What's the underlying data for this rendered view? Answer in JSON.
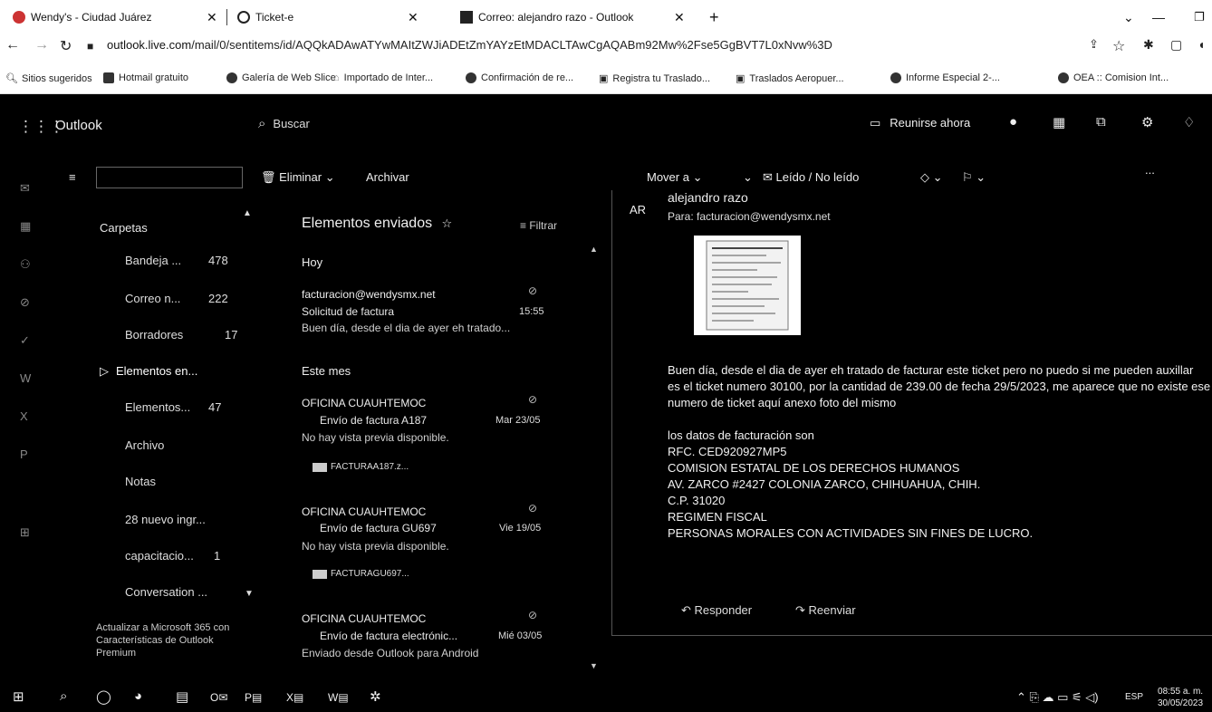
{
  "browser": {
    "tabs": [
      {
        "title": "Wendy's - Ciudad Juárez"
      },
      {
        "title": "Ticket-e"
      },
      {
        "title": "Correo: alejandro razo - Outlook"
      }
    ],
    "new_tab": "+",
    "url_host": "outlook.live.com",
    "url_path": "/mail/0/sentitems/id/AQQkADAwATYwMAItZWJiADEtZmYAYzEtMDACLTAwCgAQABm92Mw%2Fse5GgBVT7L0xNvw%3D",
    "bookmarks": [
      "Sitios sugeridos",
      "Hotmail gratuito",
      "Galería de Web Slice",
      "Importado de Inter...",
      "Confirmación de re...",
      "Registra tu Traslado...",
      "Traslados Aeropuer...",
      "Informe Especial 2-...",
      "OEA :: Comision Int..."
    ]
  },
  "outlook": {
    "brand": "Outlook",
    "search_placeholder": "Buscar",
    "meet_now": "Reunirse ahora",
    "commands": {
      "delete": "Eliminar",
      "archive": "Archivar",
      "move_to": "Mover a",
      "read_unread": "Leído / No leído",
      "more": "..."
    },
    "folders_title": "Carpetas",
    "folders": [
      {
        "label": "Bandeja ...",
        "count": "478"
      },
      {
        "label": "Correo n...",
        "count": "222"
      },
      {
        "label": "Borradores",
        "count": "17"
      },
      {
        "label": "Elementos en...",
        "count": ""
      },
      {
        "label": "Elementos...",
        "count": "47"
      },
      {
        "label": "Archivo",
        "count": ""
      },
      {
        "label": "Notas",
        "count": ""
      },
      {
        "label": "28 nuevo ingr...",
        "count": ""
      },
      {
        "label": "capacitacio...",
        "count": "1"
      },
      {
        "label": "Conversation ...",
        "count": ""
      }
    ],
    "upgrade_text": "Actualizar a Microsoft 365 con Características de Outlook Premium",
    "list": {
      "title": "Elementos enviados",
      "filter": "Filtrar",
      "groups": [
        "Hoy",
        "Este mes"
      ],
      "messages": [
        {
          "from": "facturacion@wendysmx.net",
          "subject": "Solicitud de factura",
          "date": "15:55",
          "preview": "Buen día, desde el dia de ayer eh tratado...",
          "attachment": ""
        },
        {
          "from": "OFICINA CUAUHTEMOC",
          "subject": "Envío de factura A187",
          "date": "Mar 23/05",
          "preview": "No hay vista previa disponible.",
          "attachment": "FACTURAA187.z..."
        },
        {
          "from": "OFICINA CUAUHTEMOC",
          "subject": "Envío de factura GU697",
          "date": "Vie 19/05",
          "preview": "No hay vista previa disponible.",
          "attachment": "FACTURAGU697..."
        },
        {
          "from": "OFICINA CUAUHTEMOC",
          "subject": "Envío de factura electrónic...",
          "date": "Mié 03/05",
          "preview": "Enviado desde Outlook para Android",
          "attachment": ""
        }
      ]
    },
    "reading": {
      "avatar": "AR",
      "sender": "alejandro razo",
      "to": "Para: facturacion@wendysmx.net",
      "body": [
        "Buen día, desde el dia de ayer eh tratado de facturar este ticket pero no puedo si me pueden auxillar",
        "es el ticket numero 30100, por la cantidad de 239.00 de fecha 29/5/2023, me aparece que no existe ese numero de ticket aquí anexo foto del mismo",
        "",
        "los datos de facturación son",
        "RFC. CED920927MP5",
        "COMISION ESTATAL DE LOS DERECHOS HUMANOS",
        "AV. ZARCO #2427 COLONIA ZARCO, CHIHUAHUA, CHIH.",
        "C.P. 31020",
        "REGIMEN FISCAL",
        "PERSONAS MORALES CON ACTIVIDADES SIN FINES DE LUCRO."
      ],
      "reply": "Responder",
      "forward": "Reenviar"
    }
  },
  "taskbar": {
    "lang": "ESP",
    "time": "08:55 a. m.",
    "date": "30/05/2023"
  },
  "colors": {
    "app_bg": "#000000",
    "text": "#e8e8e8",
    "divider": "#555555"
  }
}
